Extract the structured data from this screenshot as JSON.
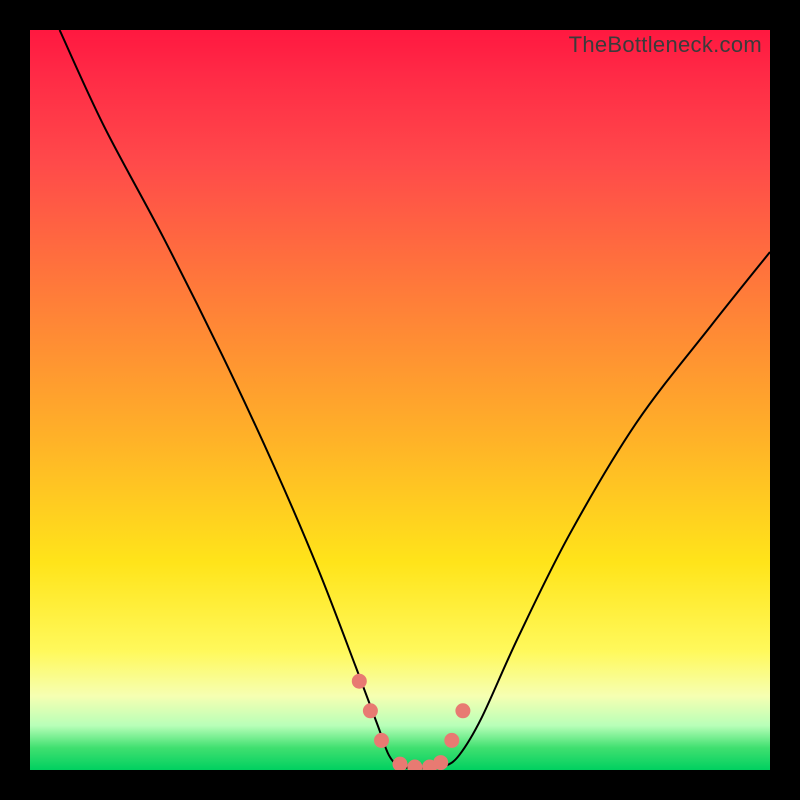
{
  "watermark": "TheBottleneck.com",
  "chart_data": {
    "type": "line",
    "title": "",
    "xlabel": "",
    "ylabel": "",
    "xlim": [
      0,
      100
    ],
    "ylim": [
      0,
      100
    ],
    "grid": false,
    "legend": false,
    "series": [
      {
        "name": "bottleneck-curve",
        "x": [
          4,
          10,
          18,
          26,
          33,
          39,
          44,
          47,
          48.5,
          50,
          52,
          54,
          56,
          58,
          61,
          66,
          73,
          82,
          92,
          100
        ],
        "y": [
          100,
          87,
          72,
          56,
          41,
          27,
          14,
          6,
          2,
          0.5,
          0.3,
          0.3,
          0.5,
          2,
          7,
          18,
          32,
          47,
          60,
          70
        ]
      }
    ],
    "markers": {
      "name": "highlight-points",
      "x": [
        44.5,
        46,
        47.5,
        50,
        52,
        54,
        55.5,
        57,
        58.5
      ],
      "y": [
        12,
        8,
        4,
        0.8,
        0.4,
        0.4,
        1,
        4,
        8
      ]
    },
    "gradient_stops": [
      {
        "pos": 0,
        "color": "#ff1840"
      },
      {
        "pos": 35,
        "color": "#ff7a3a"
      },
      {
        "pos": 72,
        "color": "#ffe41a"
      },
      {
        "pos": 100,
        "color": "#00d060"
      }
    ]
  }
}
